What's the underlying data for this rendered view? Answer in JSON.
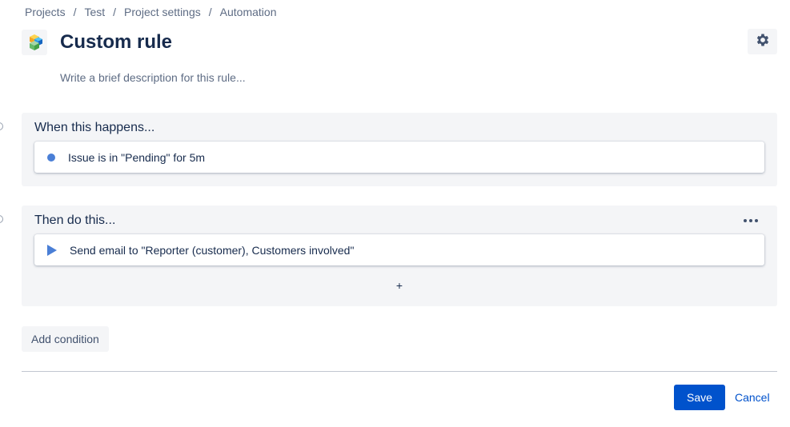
{
  "breadcrumb": {
    "items": [
      "Projects",
      "Test",
      "Project settings",
      "Automation"
    ],
    "separator": "/"
  },
  "header": {
    "title": "Custom rule",
    "description_placeholder": "Write a brief description for this rule...",
    "app_icon": "stacked-cubes-icon",
    "settings_icon": "gear-icon"
  },
  "trigger": {
    "heading": "When this happens...",
    "item": "Issue is in \"Pending\" for 5m",
    "item_icon": "dot-icon"
  },
  "actions": {
    "heading": "Then do this...",
    "item": "Send email to \"Reporter (customer), Customers involved\"",
    "item_icon": "play-icon",
    "more_icon": "ellipsis-icon",
    "add_label": "+"
  },
  "buttons": {
    "add_condition": "Add condition",
    "save": "Save",
    "cancel": "Cancel"
  },
  "colors": {
    "primary": "#0052cc",
    "panel_bg": "#f4f5f7",
    "text": "#172b4d",
    "subtle": "#5e6c84",
    "accent": "#4a7fd6"
  }
}
